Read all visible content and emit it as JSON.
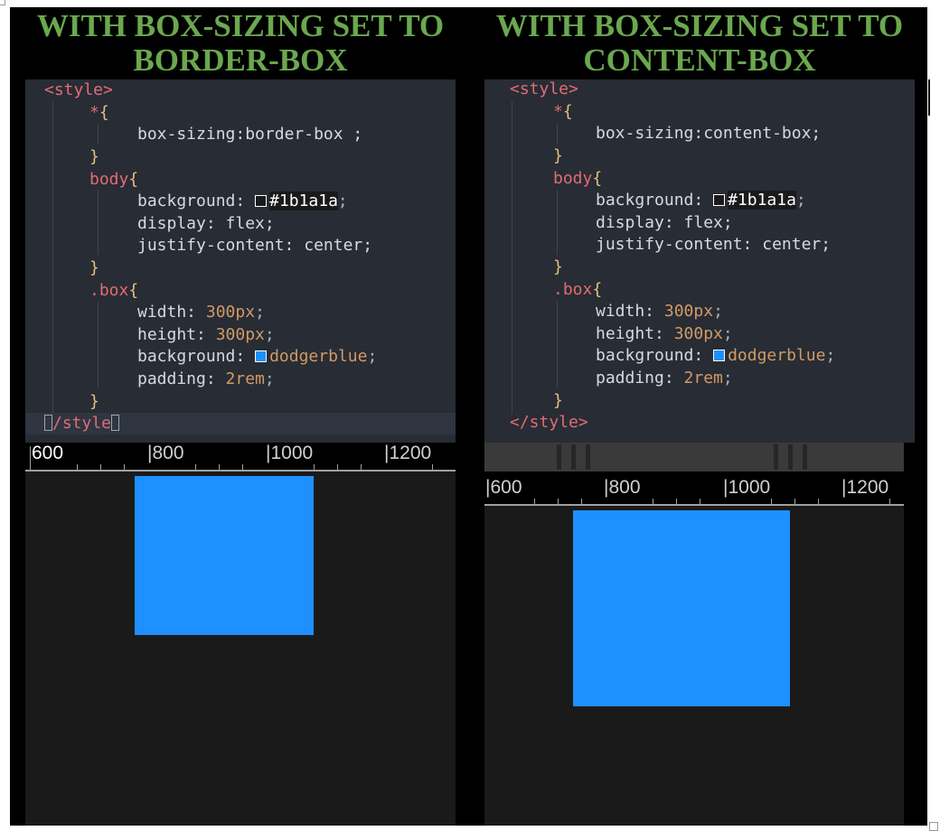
{
  "left": {
    "title_line1": "WITH BOX-SIZING SET TO",
    "title_line2": "BORDER-BOX",
    "code": {
      "open_tag": "<style>",
      "universal_selector": "*",
      "box_sizing_prop": "box-sizing:",
      "box_sizing_value": "border-box ;",
      "body_selector": "body",
      "background_prop": "background:",
      "background_value": "#1b1a1a",
      "display_prop": "display:",
      "display_value": "flex;",
      "justify_prop": "justify-content:",
      "justify_value": "center;",
      "box_selector": ".box",
      "width_prop": "width:",
      "width_value": "300px",
      "height_prop": "height:",
      "height_value": "300px",
      "box_bg_prop": "background:",
      "box_bg_value": "dodgerblue",
      "padding_prop": "padding:",
      "padding_value": "2rem",
      "close_tag_mid": "/style"
    },
    "ruler": [
      "600",
      "|800",
      "|1000",
      "|1200"
    ]
  },
  "right": {
    "title_line1": "WITH BOX-SIZING SET TO",
    "title_line2": "CONTENT-BOX",
    "code": {
      "open_tag": "<style>",
      "universal_selector": "*",
      "box_sizing_prop": "box-sizing:",
      "box_sizing_value": "content-box;",
      "body_selector": "body",
      "background_prop": "background:",
      "background_value": "#1b1a1a",
      "display_prop": "display:",
      "display_value": "flex;",
      "justify_prop": "justify-content:",
      "justify_value": "center;",
      "box_selector": ".box",
      "width_prop": "width:",
      "width_value": "300px",
      "height_prop": "height:",
      "height_value": "300px",
      "box_bg_prop": "background:",
      "box_bg_value": "dodgerblue",
      "padding_prop": "padding:",
      "padding_value": "2rem",
      "close_tag": "</style>"
    },
    "ruler": [
      "|600",
      "|800",
      "|1000",
      "|1200"
    ]
  },
  "colors": {
    "title_green": "#6aa84f",
    "editor_bg": "#282c34",
    "page_bg": "#1b1a1a",
    "box_blue": "#1e90ff"
  }
}
